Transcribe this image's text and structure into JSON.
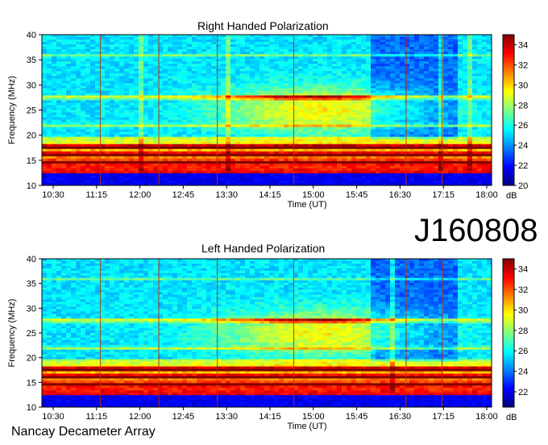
{
  "observation_id": "J160808",
  "instrument": "Nancay Decameter Array",
  "chart_data": [
    {
      "type": "heatmap",
      "title": "Right Handed Polarization",
      "xlabel": "Time (UT)",
      "ylabel": "Frequency (MHz)",
      "x_ticks": [
        "10:30",
        "11:15",
        "12:00",
        "12:45",
        "13:30",
        "14:15",
        "15:00",
        "15:45",
        "16:30",
        "17:15",
        "18:00"
      ],
      "y_ticks": [
        10,
        15,
        20,
        25,
        30,
        35,
        40
      ],
      "ylim": [
        10,
        40
      ],
      "colorbar": {
        "label": "dB",
        "ticks": [
          20,
          22,
          24,
          26,
          28,
          30,
          32,
          34
        ],
        "range": [
          20,
          35
        ]
      }
    },
    {
      "type": "heatmap",
      "title": "Left Handed Polarization",
      "xlabel": "Time (UT)",
      "ylabel": "Frequency (MHz)",
      "x_ticks": [
        "10:30",
        "11:15",
        "12:00",
        "12:45",
        "13:30",
        "14:15",
        "15:00",
        "15:45",
        "16:30",
        "17:15",
        "18:00"
      ],
      "y_ticks": [
        10,
        15,
        20,
        25,
        30,
        35,
        40
      ],
      "ylim": [
        10,
        40
      ],
      "colorbar": {
        "label": "dB",
        "ticks": [
          22,
          24,
          26,
          28,
          30,
          32,
          34
        ],
        "range": [
          20.5,
          35
        ]
      }
    }
  ]
}
